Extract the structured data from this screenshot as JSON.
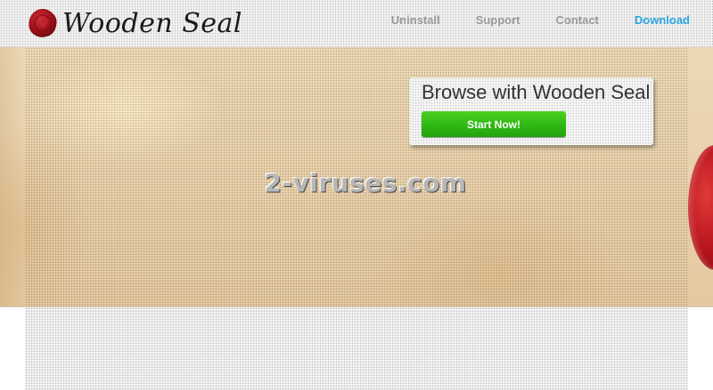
{
  "brand": {
    "name": "Wooden Seal"
  },
  "nav": {
    "items": [
      {
        "label": "Uninstall",
        "active": false
      },
      {
        "label": "Support",
        "active": false
      },
      {
        "label": "Contact",
        "active": false
      },
      {
        "label": "Download",
        "active": true
      }
    ],
    "active_color": "#2aa6e0"
  },
  "hero": {
    "promo_title": "Browse with Wooden Seal",
    "cta_label": "Start Now!",
    "cta_color": "#2fb814",
    "watermark": "2-viruses.com"
  }
}
